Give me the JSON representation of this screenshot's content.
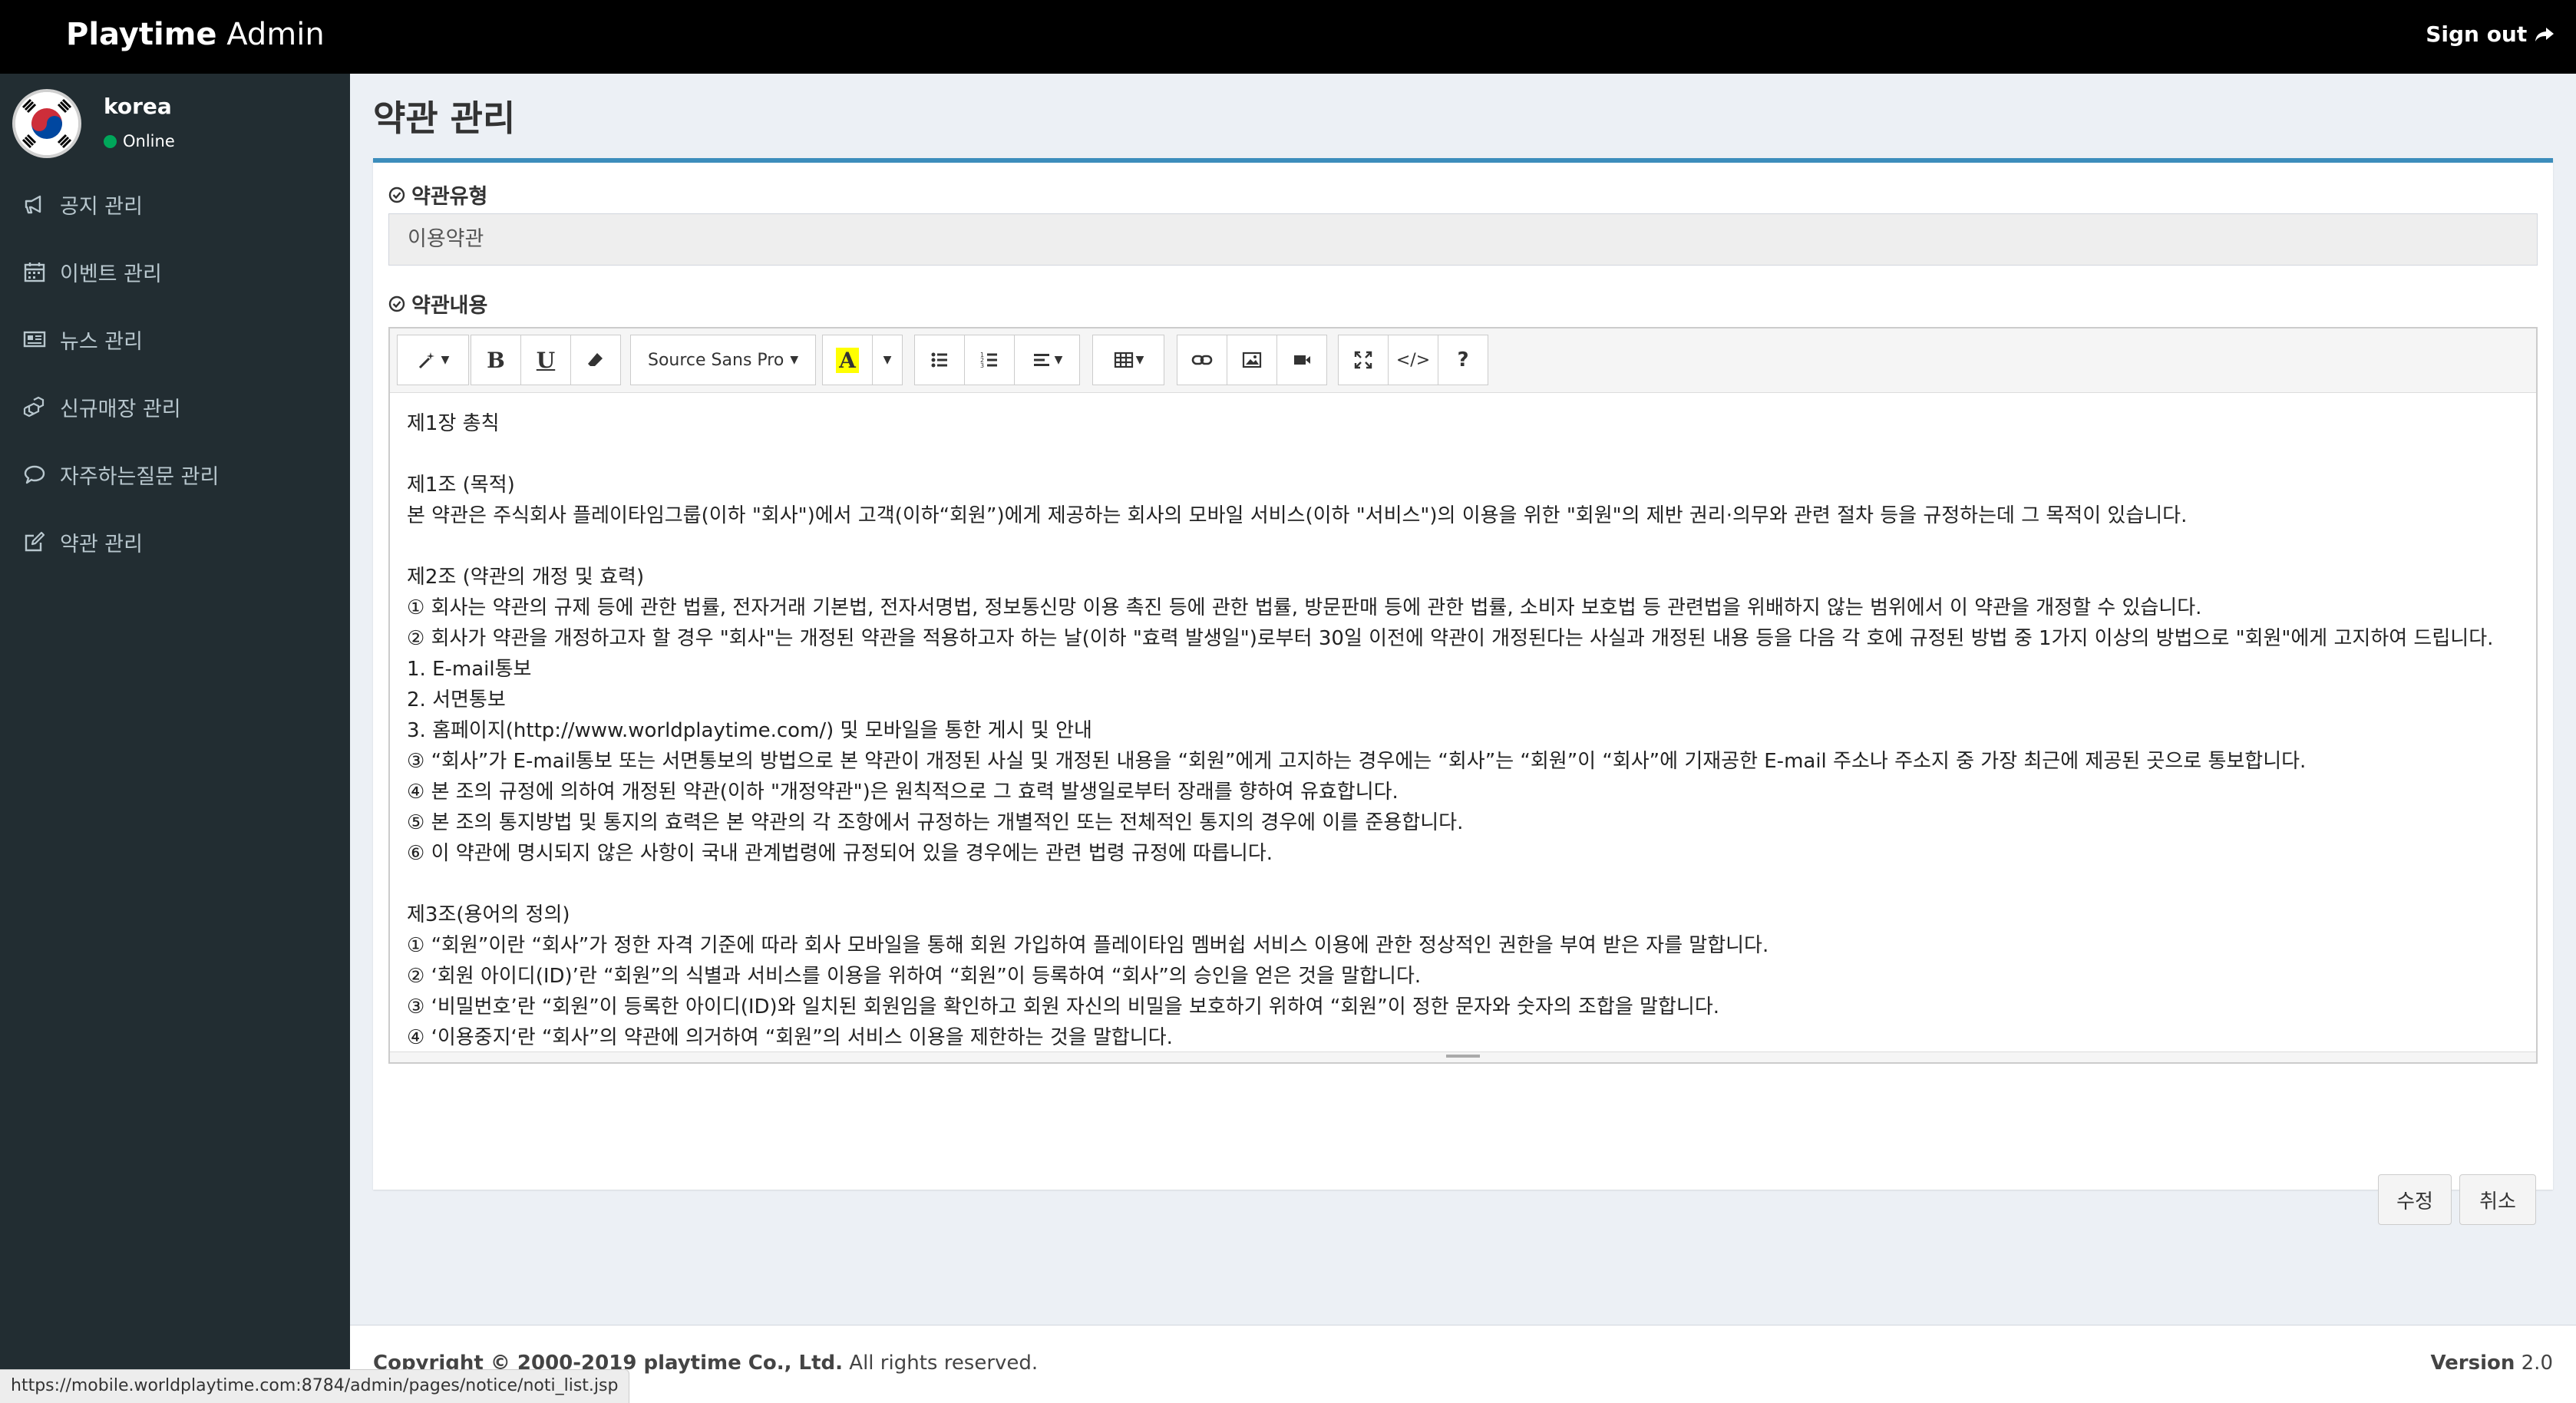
{
  "header": {
    "brand_bold": "Playtime",
    "brand_light": " Admin",
    "signout_label": "Sign out"
  },
  "user": {
    "name": "korea",
    "status": "Online"
  },
  "sidebar": {
    "items": [
      {
        "label": "공지 관리",
        "icon": "bullhorn-icon"
      },
      {
        "label": "이벤트 관리",
        "icon": "calendar-icon"
      },
      {
        "label": "뉴스 관리",
        "icon": "newspaper-icon"
      },
      {
        "label": "신규매장 관리",
        "icon": "cubes-icon"
      },
      {
        "label": "자주하는질문 관리",
        "icon": "comment-icon"
      },
      {
        "label": "약관 관리",
        "icon": "edit-icon"
      }
    ]
  },
  "page": {
    "title": "약관 관리"
  },
  "form": {
    "type_label": "약관유형",
    "type_value": "이용약관",
    "content_label": "약관내용"
  },
  "editor": {
    "font_name": "Source Sans Pro",
    "lines": [
      "제1장 총칙",
      "",
      "제1조 (목적)",
      "본 약관은 주식회사 플레이타임그룹(이하 \"회사\")에서 고객(이하“회원”)에게 제공하는 회사의 모바일 서비스(이하 \"서비스\")의 이용을 위한 \"회원\"의 제반 권리·의무와 관련 절차 등을 규정하는데 그 목적이 있습니다.",
      "",
      "제2조 (약관의 개정 및 효력)",
      "① 회사는 약관의 규제 등에 관한 법률, 전자거래 기본법, 전자서명법, 정보통신망 이용 촉진 등에 관한 법률, 방문판매 등에 관한 법률, 소비자 보호법 등 관련법을 위배하지 않는 범위에서 이 약관을 개정할 수 있습니다.",
      "② 회사가 약관을 개정하고자 할 경우 \"회사\"는 개정된 약관을 적용하고자 하는 날(이하 \"효력 발생일\")로부터 30일 이전에 약관이 개정된다는 사실과 개정된 내용 등을 다음 각 호에 규정된 방법 중 1가지 이상의 방법으로 \"회원\"에게 고지하여 드립니다.",
      "1. E-mail통보",
      "2. 서면통보",
      "3. 홈페이지(http://www.worldplaytime.com/) 및 모바일을 통한 게시 및 안내",
      "③ “회사”가 E-mail통보 또는 서면통보의 방법으로 본 약관이 개정된 사실 및 개정된 내용을 “회원”에게 고지하는 경우에는 “회사”는 “회원”이 “회사”에 기재공한 E-mail 주소나 주소지 중 가장 최근에 제공된 곳으로 통보합니다.",
      "④ 본 조의 규정에 의하여 개정된 약관(이하 \"개정약관\")은 원칙적으로 그 효력 발생일로부터 장래를 향하여 유효합니다.",
      "⑤ 본 조의 통지방법 및 통지의 효력은 본 약관의 각 조항에서 규정하는 개별적인 또는 전체적인 통지의 경우에 이를 준용합니다.",
      "⑥ 이 약관에 명시되지 않은 사항이 국내 관계법령에 규정되어 있을 경우에는 관련 법령 규정에 따릅니다.",
      "",
      "제3조(용어의 정의)",
      "① “회원”이란 “회사”가 정한 자격 기준에 따라 회사 모바일을 통해 회원 가입하여 플레이타임 멤버쉽 서비스 이용에 관한 정상적인 권한을 부여 받은 자를 말합니다.",
      "② ‘회원 아이디(ID)’란 “회원”의 식별과 서비스를 이용을 위하여 “회원”이 등록하여 “회사”의 승인을 얻은 것을 말합니다.",
      "③ ‘비밀번호’란 “회원”이 등록한 아이디(ID)와 일치된 회원임을 확인하고 회원 자신의 비밀을 보호하기 위하여 “회원”이 정한 문자와 숫자의 조합을 말합니다.",
      "④ ‘이용중지‘란 “회사”의 약관에 의거하여 “회원”의 서비스 이용을 제한하는 것을 말합니다."
    ]
  },
  "buttons": {
    "edit": "수정",
    "cancel": "취소"
  },
  "footer": {
    "copyright_bold": "Copyright © 2000-2019 playtime Co., Ltd.",
    "copyright_rest": " All rights reserved.",
    "version_label": "Version",
    "version_value": " 2.0"
  },
  "statusbar": {
    "url": "https://mobile.worldplaytime.com:8784/admin/pages/notice/noti_list.jsp"
  },
  "colors": {
    "accent": "#3c8dbc",
    "sidebar": "#222d32",
    "online": "#00a65a"
  }
}
